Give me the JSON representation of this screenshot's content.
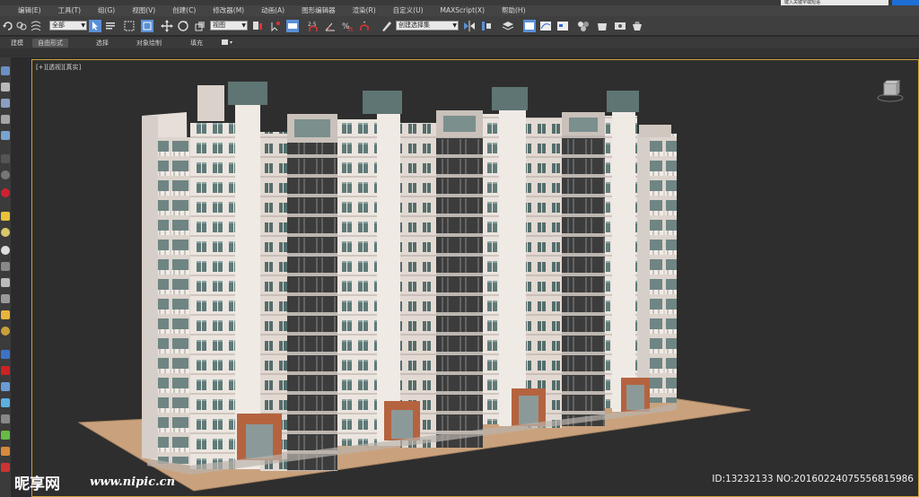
{
  "titlebar": {
    "search_placeholder": "键入关键字或短语"
  },
  "menu": {
    "items": [
      "编辑(E)",
      "工具(T)",
      "组(G)",
      "视图(V)",
      "创建(C)",
      "修改器(M)",
      "动画(A)",
      "图形编辑器",
      "渲染(R)",
      "自定义(U)",
      "MAXScript(X)",
      "帮助(H)"
    ]
  },
  "toolbar": {
    "selection_filter": "全部",
    "reference_coord": "视图",
    "named_selection": "创建选择集"
  },
  "ribbon": {
    "tabs": [
      "建模",
      "自由形式",
      "选择",
      "对象绘制",
      "填充"
    ]
  },
  "viewport": {
    "label_plus": "[+]",
    "label_view": "[透视]",
    "label_shading": "[真实]"
  },
  "watermark": {
    "logo": "昵享网",
    "url": "www.nipic.cn",
    "id_text": "ID:13232133 NO:20160224075556815986"
  },
  "colors": {
    "viewport_border": "#c9a13b",
    "facade": "#ece5df",
    "window_glass": "#5f7a78",
    "entrance": "#b5633f",
    "ground": "#c9a27d"
  }
}
